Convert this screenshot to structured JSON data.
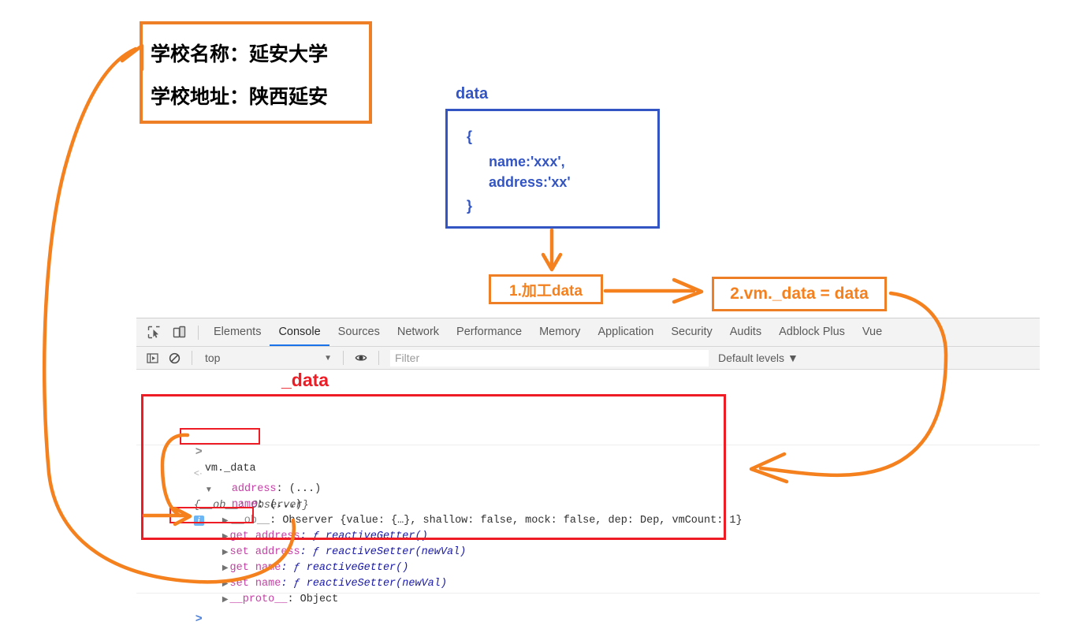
{
  "school_box": {
    "name_line": "学校名称：延安大学",
    "address_line": "学校地址：陕西延安"
  },
  "data_box": {
    "label": "data",
    "open_brace": "{",
    "name_prop": "name:'xxx',",
    "address_prop": "address:'xx'",
    "close_brace": "}"
  },
  "steps": {
    "step1": "1.加工data",
    "step2": "2.vm._data = data"
  },
  "devtools": {
    "icons": {
      "inspect": "inspect-element-icon",
      "device": "device-toolbar-icon",
      "sidebar": "console-sidebar-icon",
      "clear": "clear-console-icon",
      "eye": "live-expression-icon"
    },
    "tabs": [
      {
        "label": "Elements",
        "active": false
      },
      {
        "label": "Console",
        "active": true
      },
      {
        "label": "Sources",
        "active": false
      },
      {
        "label": "Network",
        "active": false
      },
      {
        "label": "Performance",
        "active": false
      },
      {
        "label": "Memory",
        "active": false
      },
      {
        "label": "Application",
        "active": false
      },
      {
        "label": "Security",
        "active": false
      },
      {
        "label": "Audits",
        "active": false
      },
      {
        "label": "Adblock Plus",
        "active": false
      },
      {
        "label": "Vue",
        "active": false
      }
    ],
    "filterbar": {
      "context": "top",
      "context_caret": "▼",
      "filter_placeholder": "Filter",
      "levels": "Default levels",
      "levels_caret": "▼"
    },
    "console": {
      "input_prompt": ">",
      "input_expression": "vm._data",
      "output_prompt": "<·",
      "result_header": "{__ob__: Observer}",
      "result_badge": "i",
      "rows": [
        {
          "disclosure": "",
          "key": "address",
          "key_color": "magenta",
          "value": ": (...)"
        },
        {
          "disclosure": "",
          "key": "name",
          "key_color": "magenta",
          "value": ": (...)"
        },
        {
          "disclosure": "▶",
          "key": "__ob__",
          "key_color": "grey",
          "value": ": Observer {value: {…}, shallow: false, mock: false, dep: Dep, vmCount: 1}"
        },
        {
          "disclosure": "▶",
          "key": "get address",
          "key_color": "magenta",
          "value": ": ƒ reactiveGetter()"
        },
        {
          "disclosure": "▶",
          "key": "set address",
          "key_color": "magenta",
          "value": ": ƒ reactiveSetter(newVal)"
        },
        {
          "disclosure": "▶",
          "key": "get name",
          "key_color": "magenta",
          "value": ": ƒ reactiveGetter()"
        },
        {
          "disclosure": "▶",
          "key": "set name",
          "key_color": "magenta",
          "value": ": ƒ reactiveSetter(newVal)"
        },
        {
          "disclosure": "▶",
          "key": "__proto__",
          "key_color": "magenta",
          "value": ": Object"
        }
      ],
      "bottom_prompt": ">"
    }
  },
  "annotations": {
    "red_data_label": "_data",
    "colors": {
      "orange": "#ef7f26",
      "orange_text": "#f4801e",
      "blue": "#3355c4",
      "red": "#ee1c25",
      "tab_active_underline": "#1a73e8"
    }
  }
}
